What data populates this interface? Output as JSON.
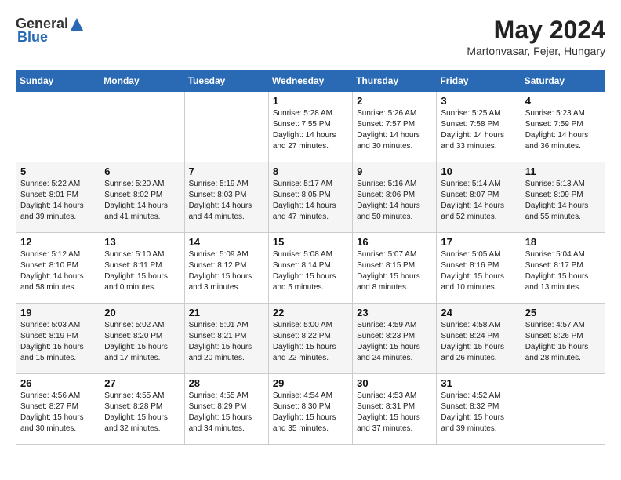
{
  "header": {
    "logo_general": "General",
    "logo_blue": "Blue",
    "month_year": "May 2024",
    "location": "Martonvasar, Fejer, Hungary"
  },
  "days_of_week": [
    "Sunday",
    "Monday",
    "Tuesday",
    "Wednesday",
    "Thursday",
    "Friday",
    "Saturday"
  ],
  "weeks": [
    [
      {
        "day": "",
        "sunrise": "",
        "sunset": "",
        "daylight": ""
      },
      {
        "day": "",
        "sunrise": "",
        "sunset": "",
        "daylight": ""
      },
      {
        "day": "",
        "sunrise": "",
        "sunset": "",
        "daylight": ""
      },
      {
        "day": "1",
        "sunrise": "Sunrise: 5:28 AM",
        "sunset": "Sunset: 7:55 PM",
        "daylight": "Daylight: 14 hours and 27 minutes."
      },
      {
        "day": "2",
        "sunrise": "Sunrise: 5:26 AM",
        "sunset": "Sunset: 7:57 PM",
        "daylight": "Daylight: 14 hours and 30 minutes."
      },
      {
        "day": "3",
        "sunrise": "Sunrise: 5:25 AM",
        "sunset": "Sunset: 7:58 PM",
        "daylight": "Daylight: 14 hours and 33 minutes."
      },
      {
        "day": "4",
        "sunrise": "Sunrise: 5:23 AM",
        "sunset": "Sunset: 7:59 PM",
        "daylight": "Daylight: 14 hours and 36 minutes."
      }
    ],
    [
      {
        "day": "5",
        "sunrise": "Sunrise: 5:22 AM",
        "sunset": "Sunset: 8:01 PM",
        "daylight": "Daylight: 14 hours and 39 minutes."
      },
      {
        "day": "6",
        "sunrise": "Sunrise: 5:20 AM",
        "sunset": "Sunset: 8:02 PM",
        "daylight": "Daylight: 14 hours and 41 minutes."
      },
      {
        "day": "7",
        "sunrise": "Sunrise: 5:19 AM",
        "sunset": "Sunset: 8:03 PM",
        "daylight": "Daylight: 14 hours and 44 minutes."
      },
      {
        "day": "8",
        "sunrise": "Sunrise: 5:17 AM",
        "sunset": "Sunset: 8:05 PM",
        "daylight": "Daylight: 14 hours and 47 minutes."
      },
      {
        "day": "9",
        "sunrise": "Sunrise: 5:16 AM",
        "sunset": "Sunset: 8:06 PM",
        "daylight": "Daylight: 14 hours and 50 minutes."
      },
      {
        "day": "10",
        "sunrise": "Sunrise: 5:14 AM",
        "sunset": "Sunset: 8:07 PM",
        "daylight": "Daylight: 14 hours and 52 minutes."
      },
      {
        "day": "11",
        "sunrise": "Sunrise: 5:13 AM",
        "sunset": "Sunset: 8:09 PM",
        "daylight": "Daylight: 14 hours and 55 minutes."
      }
    ],
    [
      {
        "day": "12",
        "sunrise": "Sunrise: 5:12 AM",
        "sunset": "Sunset: 8:10 PM",
        "daylight": "Daylight: 14 hours and 58 minutes."
      },
      {
        "day": "13",
        "sunrise": "Sunrise: 5:10 AM",
        "sunset": "Sunset: 8:11 PM",
        "daylight": "Daylight: 15 hours and 0 minutes."
      },
      {
        "day": "14",
        "sunrise": "Sunrise: 5:09 AM",
        "sunset": "Sunset: 8:12 PM",
        "daylight": "Daylight: 15 hours and 3 minutes."
      },
      {
        "day": "15",
        "sunrise": "Sunrise: 5:08 AM",
        "sunset": "Sunset: 8:14 PM",
        "daylight": "Daylight: 15 hours and 5 minutes."
      },
      {
        "day": "16",
        "sunrise": "Sunrise: 5:07 AM",
        "sunset": "Sunset: 8:15 PM",
        "daylight": "Daylight: 15 hours and 8 minutes."
      },
      {
        "day": "17",
        "sunrise": "Sunrise: 5:05 AM",
        "sunset": "Sunset: 8:16 PM",
        "daylight": "Daylight: 15 hours and 10 minutes."
      },
      {
        "day": "18",
        "sunrise": "Sunrise: 5:04 AM",
        "sunset": "Sunset: 8:17 PM",
        "daylight": "Daylight: 15 hours and 13 minutes."
      }
    ],
    [
      {
        "day": "19",
        "sunrise": "Sunrise: 5:03 AM",
        "sunset": "Sunset: 8:19 PM",
        "daylight": "Daylight: 15 hours and 15 minutes."
      },
      {
        "day": "20",
        "sunrise": "Sunrise: 5:02 AM",
        "sunset": "Sunset: 8:20 PM",
        "daylight": "Daylight: 15 hours and 17 minutes."
      },
      {
        "day": "21",
        "sunrise": "Sunrise: 5:01 AM",
        "sunset": "Sunset: 8:21 PM",
        "daylight": "Daylight: 15 hours and 20 minutes."
      },
      {
        "day": "22",
        "sunrise": "Sunrise: 5:00 AM",
        "sunset": "Sunset: 8:22 PM",
        "daylight": "Daylight: 15 hours and 22 minutes."
      },
      {
        "day": "23",
        "sunrise": "Sunrise: 4:59 AM",
        "sunset": "Sunset: 8:23 PM",
        "daylight": "Daylight: 15 hours and 24 minutes."
      },
      {
        "day": "24",
        "sunrise": "Sunrise: 4:58 AM",
        "sunset": "Sunset: 8:24 PM",
        "daylight": "Daylight: 15 hours and 26 minutes."
      },
      {
        "day": "25",
        "sunrise": "Sunrise: 4:57 AM",
        "sunset": "Sunset: 8:26 PM",
        "daylight": "Daylight: 15 hours and 28 minutes."
      }
    ],
    [
      {
        "day": "26",
        "sunrise": "Sunrise: 4:56 AM",
        "sunset": "Sunset: 8:27 PM",
        "daylight": "Daylight: 15 hours and 30 minutes."
      },
      {
        "day": "27",
        "sunrise": "Sunrise: 4:55 AM",
        "sunset": "Sunset: 8:28 PM",
        "daylight": "Daylight: 15 hours and 32 minutes."
      },
      {
        "day": "28",
        "sunrise": "Sunrise: 4:55 AM",
        "sunset": "Sunset: 8:29 PM",
        "daylight": "Daylight: 15 hours and 34 minutes."
      },
      {
        "day": "29",
        "sunrise": "Sunrise: 4:54 AM",
        "sunset": "Sunset: 8:30 PM",
        "daylight": "Daylight: 15 hours and 35 minutes."
      },
      {
        "day": "30",
        "sunrise": "Sunrise: 4:53 AM",
        "sunset": "Sunset: 8:31 PM",
        "daylight": "Daylight: 15 hours and 37 minutes."
      },
      {
        "day": "31",
        "sunrise": "Sunrise: 4:52 AM",
        "sunset": "Sunset: 8:32 PM",
        "daylight": "Daylight: 15 hours and 39 minutes."
      },
      {
        "day": "",
        "sunrise": "",
        "sunset": "",
        "daylight": ""
      }
    ]
  ]
}
